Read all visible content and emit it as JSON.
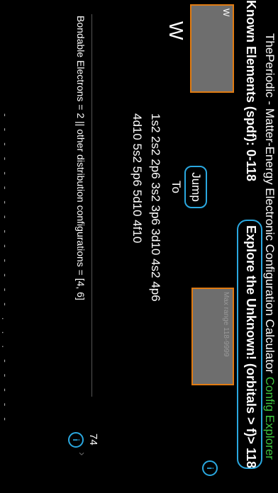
{
  "header": {
    "title_main": "ThePeriodic - Matter-Energy Electronic Configuration Calculator",
    "title_accent": "Config Explorer"
  },
  "known": {
    "label": "Known Elements (spdf): 0-118",
    "input_value": "W",
    "jump_label": "Jump To"
  },
  "explore": {
    "label": "Explore the Unknown! (orbitals > f)> 118",
    "input_placeholder": "Max range 118-9999"
  },
  "info_icon": "i",
  "element": {
    "symbol": "W",
    "configuration_line1": "1s2 2s2 2p6 3s2 3p6 3d10 4s2 4p6",
    "configuration_line2": "4d10 5s2 5p6 5d10 4f10",
    "bondable": "Bondable Electrons = 2 || other  distribution configurations = [4, 6]",
    "atomic_number": "74",
    "dots": "- - - - - -   - - - - -  - - - . . .  - - -   - -"
  },
  "colors": {
    "accent_green": "#3ec43e",
    "border_blue": "#2aa8e0",
    "border_orange": "#e07b12"
  }
}
